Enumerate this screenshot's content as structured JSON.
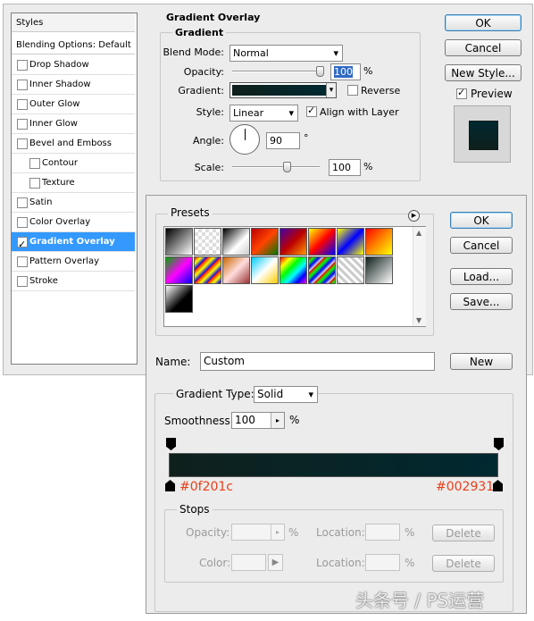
{
  "styles_panel": {
    "header": "Styles",
    "blending_options": "Blending Options: Default",
    "items": [
      {
        "label": "Drop Shadow",
        "checked": false,
        "sub": false,
        "selected": false
      },
      {
        "label": "Inner Shadow",
        "checked": false,
        "sub": false,
        "selected": false
      },
      {
        "label": "Outer Glow",
        "checked": false,
        "sub": false,
        "selected": false
      },
      {
        "label": "Inner Glow",
        "checked": false,
        "sub": false,
        "selected": false
      },
      {
        "label": "Bevel and Emboss",
        "checked": false,
        "sub": false,
        "selected": false
      },
      {
        "label": "Contour",
        "checked": false,
        "sub": true,
        "selected": false
      },
      {
        "label": "Texture",
        "checked": false,
        "sub": true,
        "selected": false
      },
      {
        "label": "Satin",
        "checked": false,
        "sub": false,
        "selected": false
      },
      {
        "label": "Color Overlay",
        "checked": false,
        "sub": false,
        "selected": false
      },
      {
        "label": "Gradient Overlay",
        "checked": true,
        "sub": false,
        "selected": true
      },
      {
        "label": "Pattern Overlay",
        "checked": false,
        "sub": false,
        "selected": false
      },
      {
        "label": "Stroke",
        "checked": false,
        "sub": false,
        "selected": false
      }
    ]
  },
  "gradient_overlay": {
    "section_title": "Gradient Overlay",
    "group_title": "Gradient",
    "blend_mode_label": "Blend Mode:",
    "blend_mode_value": "Normal",
    "opacity_label": "Opacity:",
    "opacity_value": "100",
    "opacity_unit": "%",
    "gradient_label": "Gradient:",
    "reverse_label": "Reverse",
    "style_label": "Style:",
    "style_value": "Linear",
    "align_label": "Align with Layer",
    "angle_label": "Angle:",
    "angle_value": "90",
    "angle_unit": "°",
    "scale_label": "Scale:",
    "scale_value": "100",
    "scale_unit": "%"
  },
  "layer_style_buttons": {
    "ok": "OK",
    "cancel": "Cancel",
    "new_style": "New Style...",
    "preview_label": "Preview"
  },
  "gradient_editor": {
    "presets_label": "Presets",
    "ok": "OK",
    "cancel": "Cancel",
    "load": "Load...",
    "save": "Save...",
    "name_label": "Name:",
    "name_value": "Custom",
    "new_button": "New",
    "gradient_type_label": "Gradient Type:",
    "gradient_type_value": "Solid",
    "smoothness_label": "Smoothness:",
    "smoothness_value": "100",
    "smoothness_unit": "%",
    "left_color_label": "#0f201c",
    "right_color_label": "#002931",
    "stops_label": "Stops",
    "opacity_label": "Opacity:",
    "opacity_unit": "%",
    "location_label": "Location:",
    "location_unit": "%",
    "delete_label": "Delete",
    "color_label": "Color:"
  },
  "watermark": "头条号 / PS运营",
  "colors": {
    "gradient_start": "#0f201c",
    "gradient_end": "#002931",
    "selection_blue": "#3399ff",
    "color_label_red": "#e8401c"
  }
}
